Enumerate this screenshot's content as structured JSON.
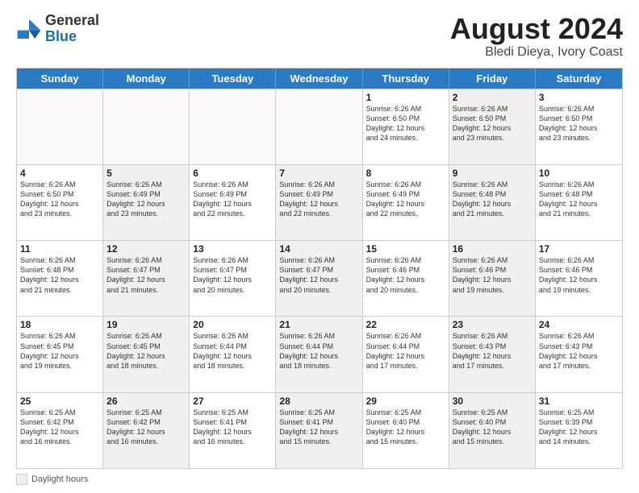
{
  "logo": {
    "general": "General",
    "blue": "Blue"
  },
  "title": "August 2024",
  "subtitle": "Bledi Dieya, Ivory Coast",
  "days": [
    "Sunday",
    "Monday",
    "Tuesday",
    "Wednesday",
    "Thursday",
    "Friday",
    "Saturday"
  ],
  "footer": {
    "legend_label": "Daylight hours"
  },
  "weeks": [
    [
      {
        "day": "",
        "info": "",
        "empty": true
      },
      {
        "day": "",
        "info": "",
        "empty": true
      },
      {
        "day": "",
        "info": "",
        "empty": true
      },
      {
        "day": "",
        "info": "",
        "empty": true
      },
      {
        "day": "1",
        "info": "Sunrise: 6:26 AM\nSunset: 6:50 PM\nDaylight: 12 hours\nand 24 minutes.",
        "empty": false
      },
      {
        "day": "2",
        "info": "Sunrise: 6:26 AM\nSunset: 6:50 PM\nDaylight: 12 hours\nand 23 minutes.",
        "empty": false,
        "shaded": true
      },
      {
        "day": "3",
        "info": "Sunrise: 6:26 AM\nSunset: 6:50 PM\nDaylight: 12 hours\nand 23 minutes.",
        "empty": false
      }
    ],
    [
      {
        "day": "4",
        "info": "Sunrise: 6:26 AM\nSunset: 6:50 PM\nDaylight: 12 hours\nand 23 minutes.",
        "empty": false
      },
      {
        "day": "5",
        "info": "Sunrise: 6:26 AM\nSunset: 6:49 PM\nDaylight: 12 hours\nand 23 minutes.",
        "empty": false,
        "shaded": true
      },
      {
        "day": "6",
        "info": "Sunrise: 6:26 AM\nSunset: 6:49 PM\nDaylight: 12 hours\nand 22 minutes.",
        "empty": false
      },
      {
        "day": "7",
        "info": "Sunrise: 6:26 AM\nSunset: 6:49 PM\nDaylight: 12 hours\nand 22 minutes.",
        "empty": false,
        "shaded": true
      },
      {
        "day": "8",
        "info": "Sunrise: 6:26 AM\nSunset: 6:49 PM\nDaylight: 12 hours\nand 22 minutes.",
        "empty": false
      },
      {
        "day": "9",
        "info": "Sunrise: 6:26 AM\nSunset: 6:48 PM\nDaylight: 12 hours\nand 21 minutes.",
        "empty": false,
        "shaded": true
      },
      {
        "day": "10",
        "info": "Sunrise: 6:26 AM\nSunset: 6:48 PM\nDaylight: 12 hours\nand 21 minutes.",
        "empty": false
      }
    ],
    [
      {
        "day": "11",
        "info": "Sunrise: 6:26 AM\nSunset: 6:48 PM\nDaylight: 12 hours\nand 21 minutes.",
        "empty": false
      },
      {
        "day": "12",
        "info": "Sunrise: 6:26 AM\nSunset: 6:47 PM\nDaylight: 12 hours\nand 21 minutes.",
        "empty": false,
        "shaded": true
      },
      {
        "day": "13",
        "info": "Sunrise: 6:26 AM\nSunset: 6:47 PM\nDaylight: 12 hours\nand 20 minutes.",
        "empty": false
      },
      {
        "day": "14",
        "info": "Sunrise: 6:26 AM\nSunset: 6:47 PM\nDaylight: 12 hours\nand 20 minutes.",
        "empty": false,
        "shaded": true
      },
      {
        "day": "15",
        "info": "Sunrise: 6:26 AM\nSunset: 6:46 PM\nDaylight: 12 hours\nand 20 minutes.",
        "empty": false
      },
      {
        "day": "16",
        "info": "Sunrise: 6:26 AM\nSunset: 6:46 PM\nDaylight: 12 hours\nand 19 minutes.",
        "empty": false,
        "shaded": true
      },
      {
        "day": "17",
        "info": "Sunrise: 6:26 AM\nSunset: 6:46 PM\nDaylight: 12 hours\nand 19 minutes.",
        "empty": false
      }
    ],
    [
      {
        "day": "18",
        "info": "Sunrise: 6:26 AM\nSunset: 6:45 PM\nDaylight: 12 hours\nand 19 minutes.",
        "empty": false
      },
      {
        "day": "19",
        "info": "Sunrise: 6:26 AM\nSunset: 6:45 PM\nDaylight: 12 hours\nand 18 minutes.",
        "empty": false,
        "shaded": true
      },
      {
        "day": "20",
        "info": "Sunrise: 6:26 AM\nSunset: 6:44 PM\nDaylight: 12 hours\nand 18 minutes.",
        "empty": false
      },
      {
        "day": "21",
        "info": "Sunrise: 6:26 AM\nSunset: 6:44 PM\nDaylight: 12 hours\nand 18 minutes.",
        "empty": false,
        "shaded": true
      },
      {
        "day": "22",
        "info": "Sunrise: 6:26 AM\nSunset: 6:44 PM\nDaylight: 12 hours\nand 17 minutes.",
        "empty": false
      },
      {
        "day": "23",
        "info": "Sunrise: 6:26 AM\nSunset: 6:43 PM\nDaylight: 12 hours\nand 17 minutes.",
        "empty": false,
        "shaded": true
      },
      {
        "day": "24",
        "info": "Sunrise: 6:26 AM\nSunset: 6:43 PM\nDaylight: 12 hours\nand 17 minutes.",
        "empty": false
      }
    ],
    [
      {
        "day": "25",
        "info": "Sunrise: 6:25 AM\nSunset: 6:42 PM\nDaylight: 12 hours\nand 16 minutes.",
        "empty": false
      },
      {
        "day": "26",
        "info": "Sunrise: 6:25 AM\nSunset: 6:42 PM\nDaylight: 12 hours\nand 16 minutes.",
        "empty": false,
        "shaded": true
      },
      {
        "day": "27",
        "info": "Sunrise: 6:25 AM\nSunset: 6:41 PM\nDaylight: 12 hours\nand 16 minutes.",
        "empty": false
      },
      {
        "day": "28",
        "info": "Sunrise: 6:25 AM\nSunset: 6:41 PM\nDaylight: 12 hours\nand 15 minutes.",
        "empty": false,
        "shaded": true
      },
      {
        "day": "29",
        "info": "Sunrise: 6:25 AM\nSunset: 6:40 PM\nDaylight: 12 hours\nand 15 minutes.",
        "empty": false
      },
      {
        "day": "30",
        "info": "Sunrise: 6:25 AM\nSunset: 6:40 PM\nDaylight: 12 hours\nand 15 minutes.",
        "empty": false,
        "shaded": true
      },
      {
        "day": "31",
        "info": "Sunrise: 6:25 AM\nSunset: 6:39 PM\nDaylight: 12 hours\nand 14 minutes.",
        "empty": false
      }
    ]
  ]
}
